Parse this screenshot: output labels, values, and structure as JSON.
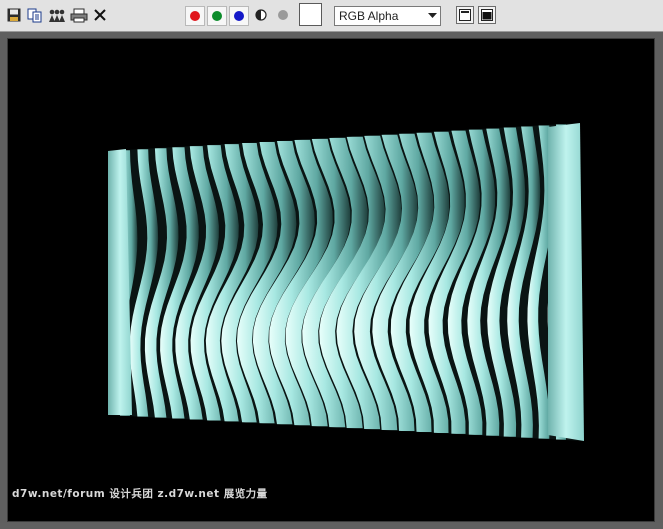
{
  "toolbar": {
    "icons": [
      "save-icon",
      "copy-icon",
      "clone-icon",
      "print-icon",
      "clear-icon"
    ],
    "channel_buttons": [
      {
        "name": "red-channel",
        "color": "#e0151b"
      },
      {
        "name": "green-channel",
        "color": "#0c8c2b"
      },
      {
        "name": "blue-channel",
        "color": "#1318c8"
      }
    ],
    "mono_icon": "half-circle-icon",
    "alpha_dot_color": "#9a9a9a",
    "background_color": "#ffffff",
    "channel_select": {
      "value": "RGB Alpha"
    },
    "frame_icons": [
      "frame-window-icon",
      "frame-fill-icon"
    ]
  },
  "render": {
    "background": "#000000",
    "object_color": "#9fe4dd",
    "watermark": "d7w.net/forum 设计兵团 z.d7w.net 展览力量"
  }
}
